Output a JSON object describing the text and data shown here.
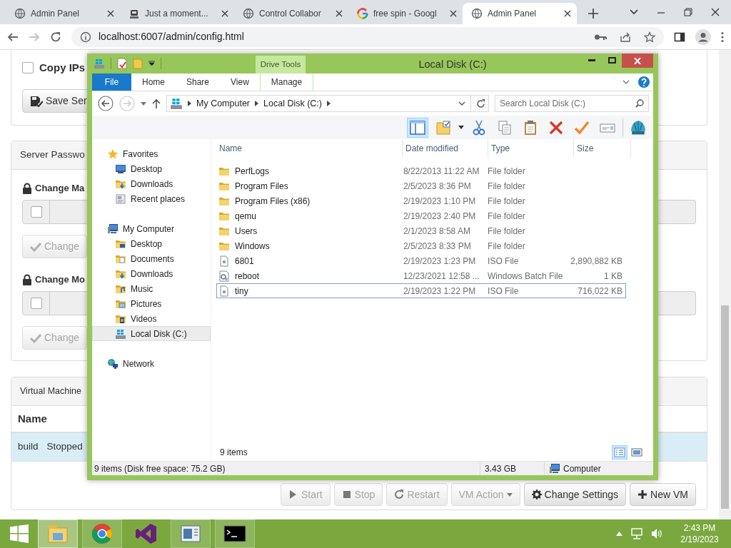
{
  "browser": {
    "tabs": [
      {
        "title": "Admin Panel",
        "kind": "globe",
        "selected": false
      },
      {
        "title": "Just a moment...",
        "kind": "robot",
        "selected": false
      },
      {
        "title": "Control Collabor",
        "kind": "globe",
        "selected": false
      },
      {
        "title": "free spin - Googl",
        "kind": "google",
        "selected": false
      },
      {
        "title": "Admin Panel",
        "kind": "globe",
        "selected": true
      }
    ],
    "url": "localhost:6007/admin/config.html"
  },
  "page": {
    "copy_ips": {
      "label": "Copy IPs",
      "checked": false
    },
    "save_button": "Save Ser",
    "passwords": {
      "title": "Server Passwo",
      "sections": [
        {
          "heading": "Change Ma",
          "checked": false,
          "button": "Change",
          "disabled": true
        },
        {
          "heading": "Change Mo",
          "checked": false,
          "button": "Change",
          "disabled": true
        }
      ]
    },
    "vms": {
      "title": "Virtual Machine",
      "columns": [
        "Name"
      ],
      "rows": [
        {
          "cells": [
            "build",
            "Stopped"
          ],
          "selected": true
        }
      ],
      "buttons": [
        {
          "label": "Start",
          "kind": "play",
          "disabled": true
        },
        {
          "label": "Stop",
          "kind": "stop",
          "disabled": true
        },
        {
          "label": "Restart",
          "kind": "restart",
          "disabled": true
        },
        {
          "label": "VM Action",
          "kind": "dropdown",
          "disabled": true
        },
        {
          "label": "Change Settings",
          "kind": "gear",
          "disabled": false
        },
        {
          "label": "New VM",
          "kind": "plus",
          "disabled": false
        }
      ]
    }
  },
  "explorer": {
    "title": "Local Disk (C:)",
    "context_tab": "Drive Tools",
    "ribbon_tabs": [
      {
        "label": "File",
        "kind": "file"
      },
      {
        "label": "Home",
        "kind": "tab"
      },
      {
        "label": "Share",
        "kind": "tab"
      },
      {
        "label": "View",
        "kind": "tab"
      },
      {
        "label": "Manage",
        "kind": "context"
      }
    ],
    "breadcrumb": [
      "My Computer",
      "Local Disk (C:)"
    ],
    "search": {
      "placeholder": "Search Local Disk (C:)"
    },
    "toolbar": [
      {
        "kind": "pane",
        "selected": true
      },
      {
        "kind": "folder-options",
        "selected": false
      },
      {
        "kind": "cut",
        "selected": false
      },
      {
        "kind": "copy",
        "selected": false
      },
      {
        "kind": "paste",
        "selected": false
      },
      {
        "kind": "delete",
        "selected": false
      },
      {
        "kind": "check",
        "selected": false
      },
      {
        "kind": "rename",
        "selected": false
      },
      {
        "kind": "shell",
        "selected": false
      }
    ],
    "nav": [
      {
        "label": "Favorites",
        "kind": "star",
        "selected": false,
        "children": [
          {
            "label": "Desktop",
            "kind": "desktop",
            "selected": false
          },
          {
            "label": "Downloads",
            "kind": "downloads",
            "selected": false
          },
          {
            "label": "Recent places",
            "kind": "recent",
            "selected": false
          }
        ]
      },
      {
        "label": "My Computer",
        "kind": "computer",
        "selected": false,
        "children": [
          {
            "label": "Desktop",
            "kind": "desktop-folder",
            "selected": false
          },
          {
            "label": "Documents",
            "kind": "documents",
            "selected": false
          },
          {
            "label": "Downloads",
            "kind": "downloads",
            "selected": false
          },
          {
            "label": "Music",
            "kind": "music",
            "selected": false
          },
          {
            "label": "Pictures",
            "kind": "pictures",
            "selected": false
          },
          {
            "label": "Videos",
            "kind": "videos",
            "selected": false
          },
          {
            "label": "Local Disk (C:)",
            "kind": "drive",
            "selected": true
          }
        ]
      },
      {
        "label": "Network",
        "kind": "network",
        "selected": false
      }
    ],
    "columns": [
      "Name",
      "Date modified",
      "Type",
      "Size"
    ],
    "files": [
      {
        "name": "PerfLogs",
        "date": "8/22/2013 11:22 AM",
        "type": "File folder",
        "kind": "folder",
        "selected": false
      },
      {
        "name": "Program Files",
        "date": "2/5/2023 8:36 PM",
        "type": "File folder",
        "kind": "folder",
        "selected": false
      },
      {
        "name": "Program Files (x86)",
        "date": "2/19/2023 1:10 PM",
        "type": "File folder",
        "kind": "folder",
        "selected": false
      },
      {
        "name": "qemu",
        "date": "2/19/2023 2:40 PM",
        "type": "File folder",
        "kind": "folder",
        "selected": false
      },
      {
        "name": "Users",
        "date": "2/1/2023 8:58 AM",
        "type": "File folder",
        "kind": "folder",
        "selected": false
      },
      {
        "name": "Windows",
        "date": "2/5/2023 8:33 PM",
        "type": "File folder",
        "kind": "folder",
        "selected": false
      },
      {
        "name": "6801",
        "date": "2/19/2023 1:23 PM",
        "type": "ISO File",
        "size": "2,890,882 KB",
        "kind": "iso",
        "selected": false
      },
      {
        "name": "reboot",
        "date": "12/23/2021 12:58 ...",
        "type": "Windows Batch File",
        "size": "1 KB",
        "kind": "batch",
        "selected": false
      },
      {
        "name": "tiny",
        "date": "2/19/2023 1:22 PM",
        "type": "ISO File",
        "size": "716,022 KB",
        "kind": "iso",
        "selected": true
      }
    ],
    "item_count": "9 items",
    "views": [
      {
        "kind": "details",
        "selected": true
      },
      {
        "kind": "large",
        "selected": false
      }
    ],
    "status": {
      "summary": "9 items (Disk free space: 75.2 GB)",
      "size": "3.43 GB",
      "location": "Computer"
    }
  },
  "taskbar": {
    "apps": [
      {
        "kind": "explorer",
        "running": true,
        "active": true
      },
      {
        "kind": "chrome",
        "running": true,
        "active": false
      },
      {
        "kind": "studio",
        "running": false,
        "active": false
      },
      {
        "kind": "window",
        "running": true,
        "active": false
      },
      {
        "kind": "terminal",
        "running": true,
        "active": false
      }
    ],
    "time": "2:43 PM",
    "date": "2/19/2023"
  }
}
